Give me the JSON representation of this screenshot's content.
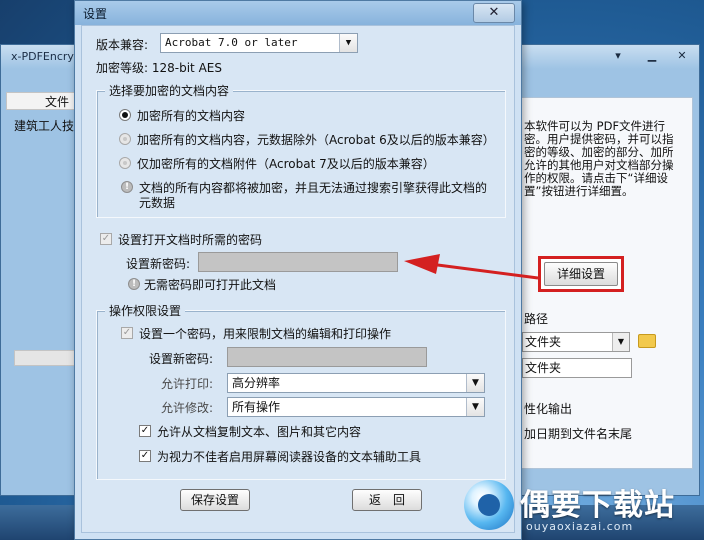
{
  "background_window": {
    "title": "x-PDFEncry",
    "list_header": "文件",
    "list_item": "建筑工人技",
    "right_text": "本软件可以为 PDF文件进行密。用户提供密码，并可以指密的等级、加密的部分、加所允许的其他用户对文档部分操作的权限。请点击下“详细设置”按钮进行详细置。",
    "detail_button": "详细设置",
    "path_label": "路径",
    "folder_combo": "文件夹",
    "folder_input": "文件夹",
    "option1": "性化输出",
    "option2": "加日期到文件名末尾"
  },
  "dialog": {
    "title": "设置",
    "close_label": "✕",
    "version_label": "版本兼容:",
    "version_value": "Acrobat 7.0 or later",
    "encryption_level": "加密等级:  128-bit AES",
    "content_group": {
      "title": "选择要加密的文档内容",
      "options": [
        {
          "label": "加密所有的文档内容",
          "selected": true,
          "enabled": true
        },
        {
          "label": "加密所有的文档内容，元数据除外（Acrobat 6及以后的版本兼容）",
          "selected": false,
          "enabled": false
        },
        {
          "label": "仅加密所有的文档附件（Acrobat 7及以后的版本兼容）",
          "selected": false,
          "enabled": false
        }
      ],
      "info_line1": "文档的所有内容都将被加密，并且无法通过搜索引擎获得此文档的",
      "info_line2": "元数据"
    },
    "open_password": {
      "checkbox_label": "设置打开文档时所需的密码",
      "checked": true,
      "new_password_label": "设置新密码:",
      "info": "无需密码即可打开此文档"
    },
    "permissions": {
      "title": "操作权限设置",
      "checkbox_label": "设置一个密码，用来限制文档的编辑和打印操作",
      "checked": true,
      "new_password_label": "设置新密码:",
      "print_label": "允许打印:",
      "print_value": "高分辨率",
      "modify_label": "允许修改:",
      "modify_value": "所有操作",
      "copy_label": "允许从文档复制文本、图片和其它内容",
      "copy_checked": true,
      "accessibility_label": "为视力不佳者启用屏幕阅读器设备的文本辅助工具",
      "accessibility_checked": true
    },
    "save_button": "保存设置",
    "back_button": "返　回"
  },
  "watermark": {
    "title": "偶要下载站",
    "subtitle": "ouyaoxiazai.com"
  },
  "colors": {
    "highlight": "#d42020",
    "dialog_bg": "#d8e6f4"
  }
}
